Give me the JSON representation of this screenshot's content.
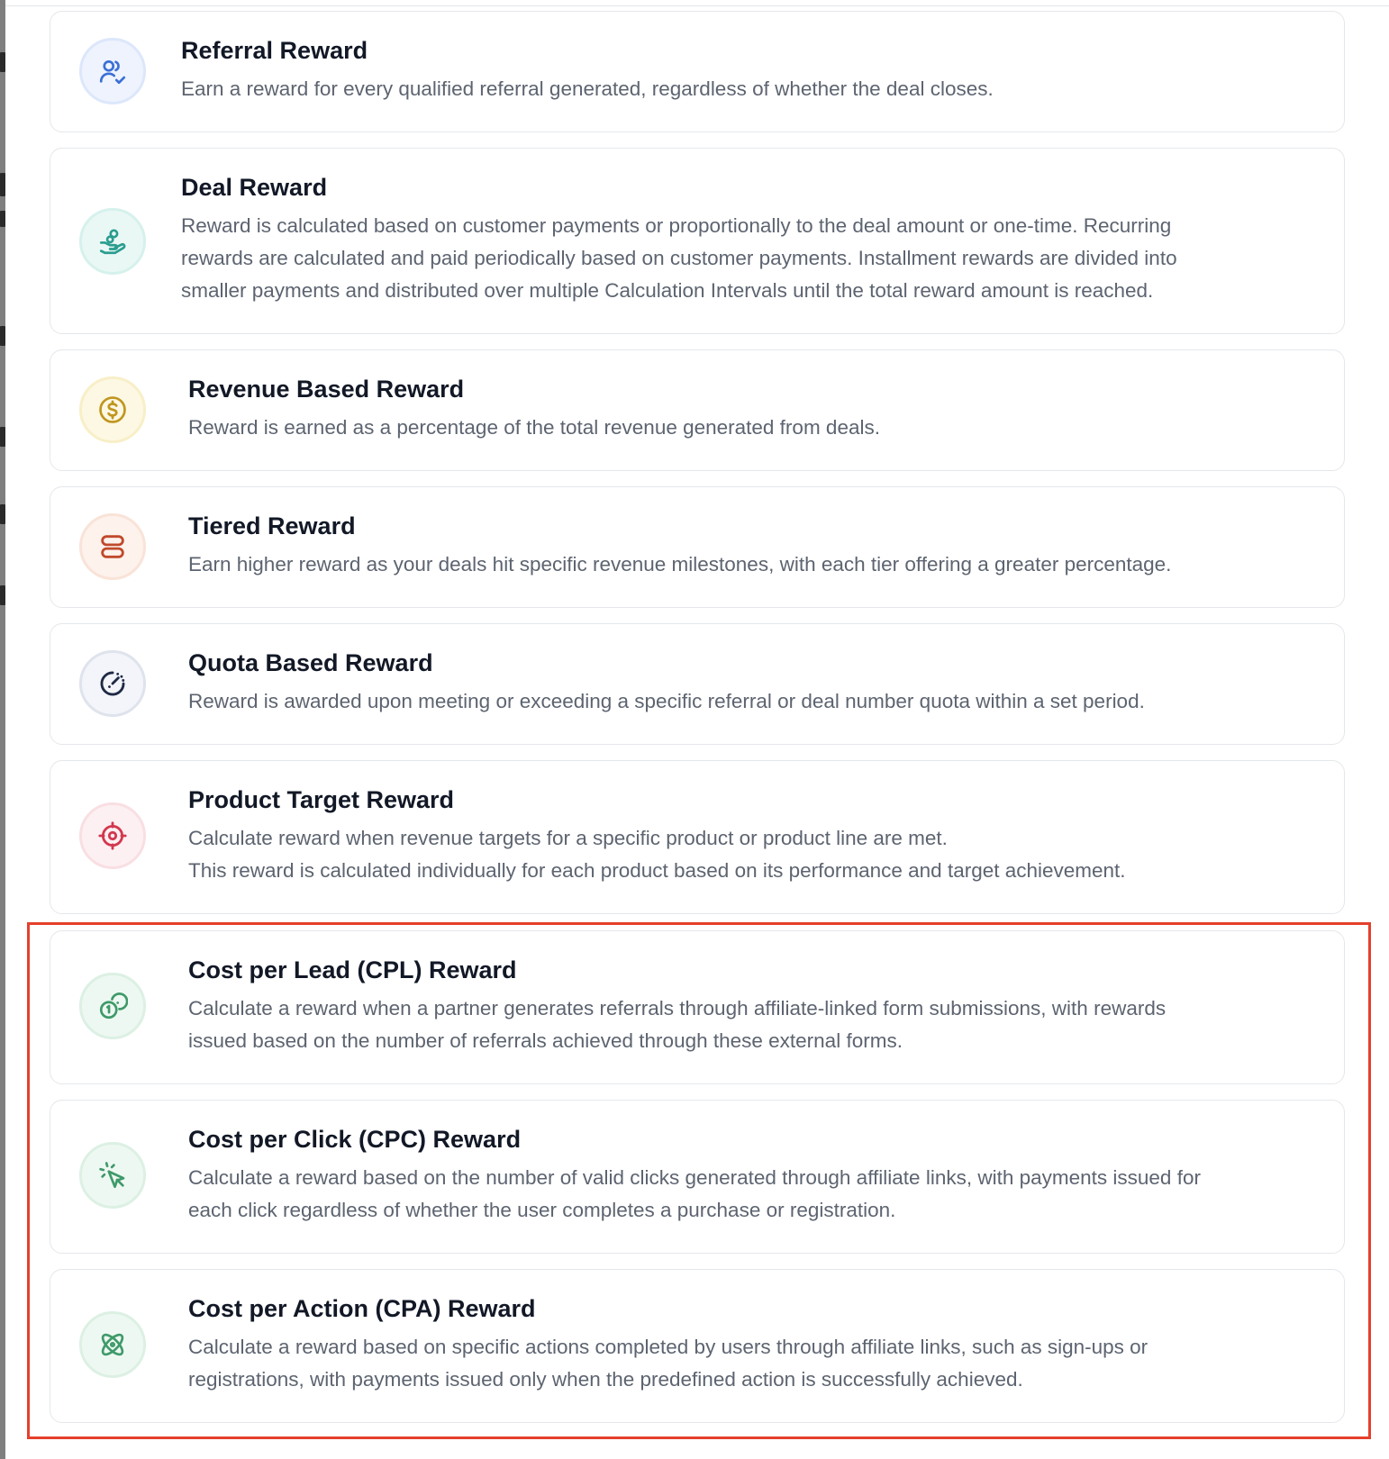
{
  "colors": {
    "card_border": "#e4e7eb",
    "title": "#121826",
    "description": "#5d6470",
    "highlight": "#e5402c"
  },
  "rewards": [
    {
      "title": "Referral Reward",
      "description": "Earn a reward for every qualified referral generated, regardless of whether the deal closes.",
      "icon": "users-check-icon",
      "icon_color": "#3b6fd6",
      "icon_bg": "#eef3fd",
      "icon_border": "#dde7fb"
    },
    {
      "title": "Deal Reward",
      "description": "Reward is calculated based on customer payments or proportionally to the deal amount or one-time. Recurring\nrewards are calculated and paid periodically based on customer payments. Installment rewards are divided into\nsmaller payments and distributed over multiple Calculation Intervals until the total reward amount is reached.",
      "icon": "hand-coins-icon",
      "icon_color": "#2a9d8f",
      "icon_bg": "#eaf8f5",
      "icon_border": "#d6f1ec"
    },
    {
      "title": "Revenue Based Reward",
      "description": "Reward is earned as a percentage of the total revenue generated from deals.",
      "icon": "dollar-circle-icon",
      "icon_color": "#c0961f",
      "icon_bg": "#fdf8e4",
      "icon_border": "#f8efc8"
    },
    {
      "title": "Tiered Reward",
      "description": "Earn higher reward as your deals hit specific revenue milestones, with each tier offering a greater percentage.",
      "icon": "tiers-icon",
      "icon_color": "#c0492b",
      "icon_bg": "#fdf2ec",
      "icon_border": "#f9e3d8"
    },
    {
      "title": "Quota Based Reward",
      "description": "Reward is awarded upon meeting or exceeding a specific referral or deal number quota within a set period.",
      "icon": "gauge-icon",
      "icon_color": "#1f2a44",
      "icon_bg": "#f3f5fa",
      "icon_border": "#dfe3ec"
    },
    {
      "title": "Product Target Reward",
      "description": "Calculate reward when revenue targets for a specific product or product line are met.\nThis reward is calculated individually for each product based on its performance and target achievement.",
      "icon": "crosshair-icon",
      "icon_color": "#d2384f",
      "icon_bg": "#fdf0f2",
      "icon_border": "#f8dfe3"
    },
    {
      "title": "Cost per Lead (CPL) Reward",
      "description": "Calculate a reward when a partner generates referrals through affiliate-linked form submissions, with rewards\nissued based on the number of referrals achieved through these external forms.",
      "icon": "coins-icon",
      "icon_color": "#3f9a6a",
      "icon_bg": "#eef8f2",
      "icon_border": "#dcf0e4"
    },
    {
      "title": "Cost per Click (CPC) Reward",
      "description": "Calculate a reward based on the number of valid clicks generated through affiliate links, with payments issued for\neach click regardless of whether the user completes a purchase or registration.",
      "icon": "mouse-pointer-click-icon",
      "icon_color": "#3f9a6a",
      "icon_bg": "#eef8f2",
      "icon_border": "#dcf0e4"
    },
    {
      "title": "Cost per Action (CPA) Reward",
      "description": "Calculate a reward based on specific actions completed by users through affiliate links, such as sign-ups or\nregistrations, with payments issued only when the predefined action is successfully achieved.",
      "icon": "atom-icon",
      "icon_color": "#3f9a6a",
      "icon_bg": "#eef8f2",
      "icon_border": "#dcf0e4"
    }
  ]
}
